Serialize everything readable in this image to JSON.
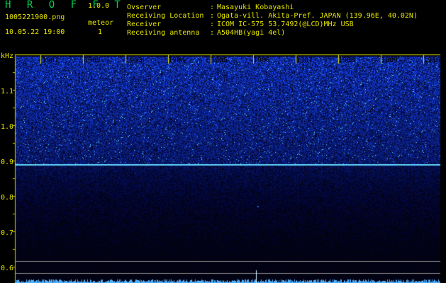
{
  "app": {
    "name": "H R O F F T",
    "version": "1.0.0"
  },
  "file": {
    "name": "1005221900.png",
    "datetime": "10.05.22 19:00"
  },
  "detection": {
    "label": "meteor",
    "count": "1"
  },
  "station": [
    {
      "label": "Ovserver",
      "value": "Masayuki Kobayashi"
    },
    {
      "label": "Receiving Location",
      "value": "Ogata-vill. Akita-Pref. JAPAN (139.96E, 40.02N)"
    },
    {
      "label": "Receiver",
      "value": "ICOM IC-575 53.7492(@LCD)MHz USB"
    },
    {
      "label": "Receiving antenna",
      "value": "A504HB(yagi 4el)"
    }
  ],
  "spectrogram": {
    "unit_label": "kHz",
    "y_ticks": [
      "1.1",
      "1.0",
      "0.9",
      "0.8",
      "0.7",
      "0.6"
    ],
    "time_ticks": [
      "1901",
      "1902",
      "1903",
      "1904",
      "1905",
      "1906",
      "1907",
      "1908",
      "1909",
      "1910"
    ],
    "carrier_khz": 0.89,
    "colors": {
      "background": "#000000",
      "noise": "#1a3cd8",
      "carrier": "#60d8ff",
      "text": "#e6e600",
      "title": "#00d050"
    }
  }
}
